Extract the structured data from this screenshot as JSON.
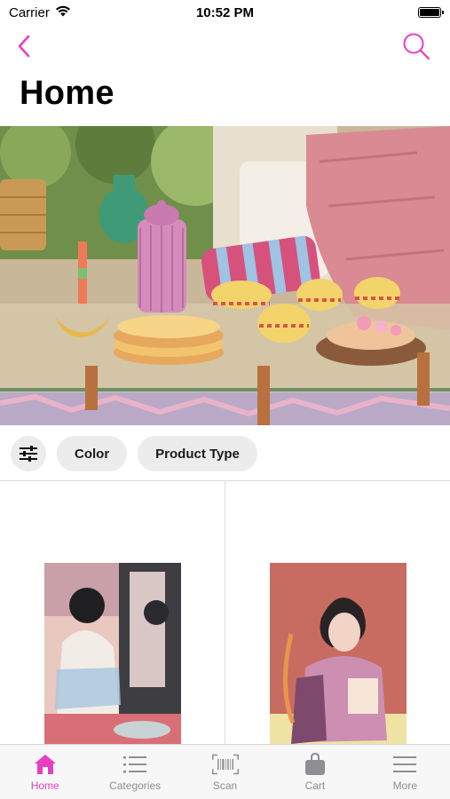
{
  "status_bar": {
    "carrier": "Carrier",
    "time": "10:52 PM"
  },
  "colors": {
    "accent": "#e63fc2",
    "chip_bg": "#ececec",
    "inactive": "#8e8e93"
  },
  "nav": {
    "back_icon": "chevron-left-icon",
    "search_icon": "search-icon"
  },
  "page": {
    "title": "Home"
  },
  "filters": {
    "icon": "sliders-icon",
    "chips": [
      {
        "label": "Color"
      },
      {
        "label": "Product Type"
      }
    ]
  },
  "tab_bar": {
    "items": [
      {
        "label": "Home",
        "icon": "home-icon",
        "active": true
      },
      {
        "label": "Categories",
        "icon": "list-icon",
        "active": false
      },
      {
        "label": "Scan",
        "icon": "barcode-icon",
        "active": false
      },
      {
        "label": "Cart",
        "icon": "bag-icon",
        "active": false
      },
      {
        "label": "More",
        "icon": "menu-icon",
        "active": false
      }
    ]
  }
}
